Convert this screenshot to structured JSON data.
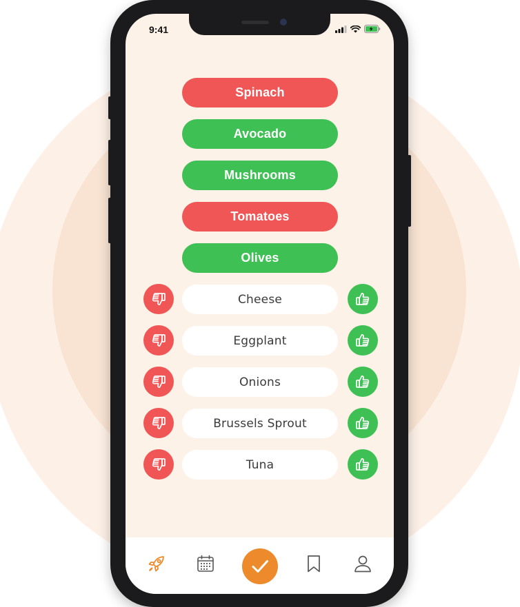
{
  "status_bar": {
    "time": "9:41"
  },
  "rated_items": [
    {
      "label": "Spinach",
      "rating": "dislike"
    },
    {
      "label": "Avocado",
      "rating": "like"
    },
    {
      "label": "Mushrooms",
      "rating": "like"
    },
    {
      "label": "Tomatoes",
      "rating": "dislike"
    },
    {
      "label": "Olives",
      "rating": "like"
    }
  ],
  "unrated_items": [
    {
      "label": "Cheese"
    },
    {
      "label": "Eggplant"
    },
    {
      "label": "Onions"
    },
    {
      "label": "Brussels Sprout"
    },
    {
      "label": "Tuna"
    }
  ],
  "vote_icons": {
    "dislike": "thumbs-down-icon",
    "like": "thumbs-up-icon"
  },
  "tab_bar": {
    "items": [
      {
        "icon": "rocket-icon",
        "active": true
      },
      {
        "icon": "calendar-icon",
        "active": false
      },
      {
        "icon": "checkmark-icon",
        "active": false
      },
      {
        "icon": "bookmark-icon",
        "active": false
      },
      {
        "icon": "profile-icon",
        "active": false
      }
    ]
  },
  "colors": {
    "like": "#3fc054",
    "dislike": "#f05656",
    "accent": "#ed8a2c",
    "screen_background": "#fdf2e7"
  }
}
